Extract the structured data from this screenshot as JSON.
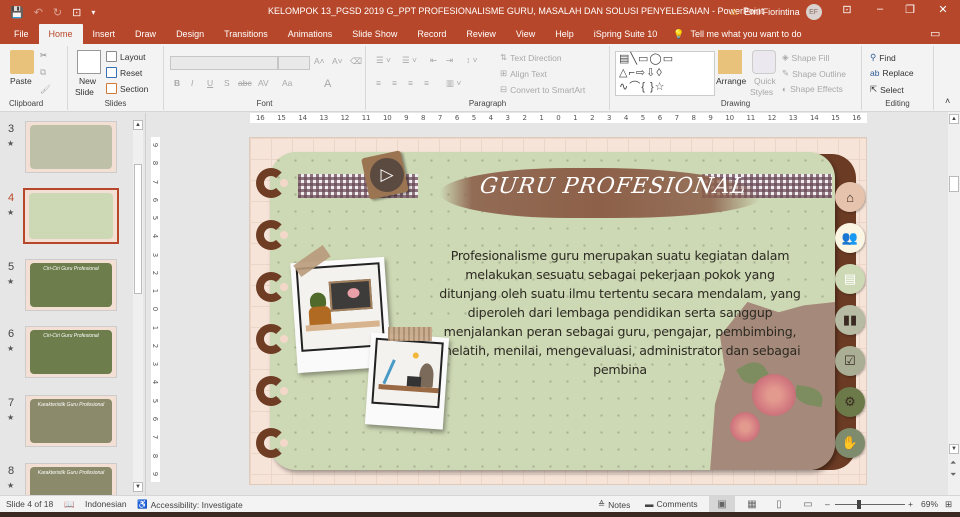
{
  "window": {
    "title": "KELOMPOK 13_PGSD 2019 G_PPT PROFESIONALISME GURU, MASALAH DAN SOLUSI PENYELESAIAN  -  PowerPoint",
    "user_name": "Erni Fiorintina",
    "user_initials": "EF",
    "warning_icon": "warning-icon",
    "accent_color": "#b7472a"
  },
  "quick_access": [
    "save-icon",
    "undo-icon",
    "redo-icon",
    "present-from-start-icon",
    "customize-icon"
  ],
  "tabs": [
    {
      "label": "File"
    },
    {
      "label": "Home",
      "active": true
    },
    {
      "label": "Insert"
    },
    {
      "label": "Draw"
    },
    {
      "label": "Design"
    },
    {
      "label": "Transitions"
    },
    {
      "label": "Animations"
    },
    {
      "label": "Slide Show"
    },
    {
      "label": "Record"
    },
    {
      "label": "Review"
    },
    {
      "label": "View"
    },
    {
      "label": "Help"
    },
    {
      "label": "iSpring Suite 10"
    }
  ],
  "tell_me": "Tell me what you want to do",
  "ribbon": {
    "clipboard": {
      "label": "Clipboard",
      "paste": "Paste"
    },
    "slides": {
      "label": "Slides",
      "new_slide_1": "New",
      "new_slide_2": "Slide",
      "layout": "Layout",
      "reset": "Reset",
      "section": "Section"
    },
    "font": {
      "label": "Font",
      "bold": "B",
      "italic": "I",
      "underline": "U",
      "shadow": "S",
      "strike": "abc",
      "spacing": "AV",
      "case": "Aa",
      "color": "A"
    },
    "paragraph": {
      "label": "Paragraph",
      "text_direction": "Text Direction",
      "align_text": "Align Text",
      "smartart": "Convert to SmartArt"
    },
    "drawing": {
      "label": "Drawing",
      "arrange": "Arrange",
      "quick_styles_1": "Quick",
      "quick_styles_2": "Styles",
      "shape_fill": "Shape Fill",
      "shape_outline": "Shape Outline",
      "shape_effects": "Shape Effects"
    },
    "editing": {
      "label": "Editing",
      "find": "Find",
      "replace": "Replace",
      "select": "Select"
    }
  },
  "ruler": {
    "horizontal": [
      "16",
      "15",
      "14",
      "13",
      "12",
      "11",
      "10",
      "9",
      "8",
      "7",
      "6",
      "5",
      "4",
      "3",
      "2",
      "1",
      "0",
      "1",
      "2",
      "3",
      "4",
      "5",
      "6",
      "7",
      "8",
      "9",
      "10",
      "11",
      "12",
      "13",
      "14",
      "15",
      "16"
    ],
    "vertical": [
      "9",
      "8",
      "7",
      "6",
      "5",
      "4",
      "3",
      "2",
      "1",
      "0",
      "1",
      "2",
      "3",
      "4",
      "5",
      "6",
      "7",
      "8",
      "9"
    ]
  },
  "thumbnails": [
    {
      "num": "3",
      "title": "",
      "bg": "#bfc0a8",
      "selected": false
    },
    {
      "num": "4",
      "title": "",
      "bg": "#cdd8b4",
      "selected": true
    },
    {
      "num": "5",
      "title": "Ciri-Ciri Guru Profesional",
      "bg": "#6d7d4b",
      "selected": false
    },
    {
      "num": "6",
      "title": "Ciri-Ciri Guru Profesional",
      "bg": "#6d7d4b",
      "selected": false
    },
    {
      "num": "7",
      "title": "Karakteristik Guru Profesional",
      "bg": "#8b8a6a",
      "selected": false
    },
    {
      "num": "8",
      "title": "Karakteristik Guru Profesional",
      "bg": "#8b8a6a",
      "selected": false
    }
  ],
  "slide": {
    "title": "GURU PROFESIONAL",
    "body": "Profesionalisme guru merupakan suatu kegiatan dalam melakukan sesuatu sebagai pekerjaan pokok yang ditunjang oleh suatu ilmu tertentu secara mendalam, yang diperoleh dari lembaga pendidikan serta sanggup menjalankan peran sebagai guru, pengajar, pembimbing, melatih, menilai, mengevaluasi, administrator dan sebagai pembina",
    "nav_buttons": [
      {
        "icon": "home-icon",
        "glyph": "⌂",
        "bg": "#e6c3ad",
        "fg": "#3a2a22"
      },
      {
        "icon": "people-icon",
        "glyph": "👥",
        "bg": "#fbf5e3",
        "fg": "#3a2a22"
      },
      {
        "icon": "comment-icon",
        "glyph": "▤",
        "bg": "#cdd8b4",
        "fg": "#ffffff"
      },
      {
        "icon": "chart-icon",
        "glyph": "▮▮",
        "bg": "#b7bba4",
        "fg": "#3a2a22"
      },
      {
        "icon": "calendar-icon",
        "glyph": "☑",
        "bg": "#a9ae94",
        "fg": "#3a2a22"
      },
      {
        "icon": "gear-icon",
        "glyph": "⚙",
        "bg": "#6c7a4a",
        "fg": "#3a2a22"
      },
      {
        "icon": "hand-icon",
        "glyph": "✋",
        "bg": "#7e8b6c",
        "fg": "#3a2a22"
      }
    ]
  },
  "status": {
    "slide_info": "Slide 4 of 18",
    "language": "Indonesian",
    "accessibility": "Accessibility: Investigate",
    "notes": "Notes",
    "comments": "Comments",
    "zoom": "69%"
  }
}
